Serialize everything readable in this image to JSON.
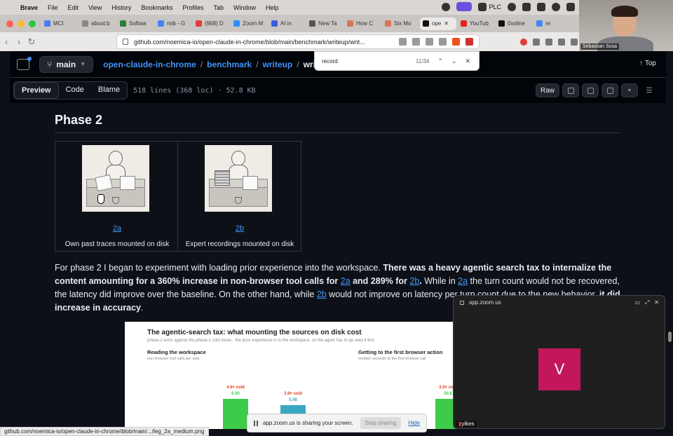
{
  "menubar": {
    "app": "Brave",
    "items": [
      "File",
      "Edit",
      "View",
      "History",
      "Bookmarks",
      "Profiles",
      "Tab",
      "Window",
      "Help"
    ],
    "status_plc": "PLC",
    "status_icons": [
      "record-icon",
      "screen-share-icon",
      "shield-icon",
      "github-icon",
      "dashboard-icon",
      "control-center-icon",
      "wifi-icon",
      "battery-icon"
    ]
  },
  "tabs": [
    {
      "label": "MCI",
      "color": "#4a7cf3"
    },
    {
      "label": "about:b",
      "color": "#888888"
    },
    {
      "label": "Softwa",
      "color": "#2e7d32"
    },
    {
      "label": "mib - G",
      "color": "#4285f4"
    },
    {
      "label": "(968) D",
      "color": "#e23b3b"
    },
    {
      "label": "Zoom M",
      "color": "#2d8cff"
    },
    {
      "label": "AI in",
      "color": "#3b5bdb"
    },
    {
      "label": "New Ta",
      "color": "#555555"
    },
    {
      "label": "How C",
      "color": "#d97757"
    },
    {
      "label": "Six Mo",
      "color": "#d97757"
    },
    {
      "label": "ope",
      "color": "#111111",
      "active": true
    },
    {
      "label": "YouTub",
      "color": "#e62117"
    },
    {
      "label": "0xsline",
      "color": "#111111"
    },
    {
      "label": "re",
      "color": "#4285f4"
    }
  ],
  "addressbar": {
    "url": "github.com/noemica-io/open-claude-in-chrome/blob/main/benchmark/writeup/writ..."
  },
  "webcam": {
    "name": "Sebastian Sosa"
  },
  "findbar": {
    "query": "record",
    "count": "11/34"
  },
  "github": {
    "branch": "main",
    "breadcrumbs": [
      "open-claude-in-chrome",
      "benchmark",
      "writeup"
    ],
    "current": "writeup",
    "top_link": "Top",
    "views": [
      "Preview",
      "Code",
      "Blame"
    ],
    "active_view": "Preview",
    "file_info": "518 lines (368 loc) · 52.8 KB",
    "raw_label": "Raw"
  },
  "doc": {
    "heading": "Phase 2",
    "images": [
      {
        "link": "2a",
        "caption": "Own past traces mounted on disk"
      },
      {
        "link": "2b",
        "caption": "Expert recordings mounted on disk"
      }
    ],
    "para": {
      "t1": "For phase 2 I began to experiment with loading prior experience into the workspace. ",
      "b1": "There was a heavy agentic search tax to internalize the content amounting for a 360% increase in non-browser tool calls for ",
      "l1": "2a",
      "b2": " and 289% for ",
      "l2": "2b",
      "b3": ".",
      "t2": " While in ",
      "l3": "2a",
      "t3": " the turn count would not be recovered, the latency did improve over the baseline. On the other hand, while ",
      "l4": "2b",
      "t4": " would not improve on latency per turn count due to the new behavior, ",
      "b4": "it did increase in accuracy",
      "t5": "."
    }
  },
  "chart_data": {
    "type": "bar",
    "title": "The agentic-search tax: what mounting the sources on disk cost",
    "subtitle": "phase-2 arms against the phase-1 cold mean · the prior experience is in the workspace, so the agent has to go read it first",
    "panels": [
      {
        "title": "Reading the workspace",
        "subtitle": "non-browser tool calls per task",
        "bars": [
          {
            "label": "4.6× cold",
            "value": "6.00",
            "color": "#3dcc4a"
          },
          {
            "label": "3.9× cold",
            "value": "5.08",
            "color": "#39a7c2"
          }
        ]
      },
      {
        "title": "Getting to the first browser action",
        "subtitle": "median seconds to the first browser call",
        "bars": [
          {
            "label": "3.5× cold",
            "value": "20.8",
            "color": "#3dcc4a"
          }
        ]
      }
    ]
  },
  "zoom": {
    "title": "app.zoom.us",
    "avatar": "V",
    "participant": "yikes"
  },
  "sharebar": {
    "text": "app.zoom.us is sharing your screen.",
    "stop": "Stop sharing",
    "hide": "Hide"
  },
  "status_url": "github.com/noemica-io/open-claude-in-chrome/blob/main/.../leg_2a_medium.png"
}
